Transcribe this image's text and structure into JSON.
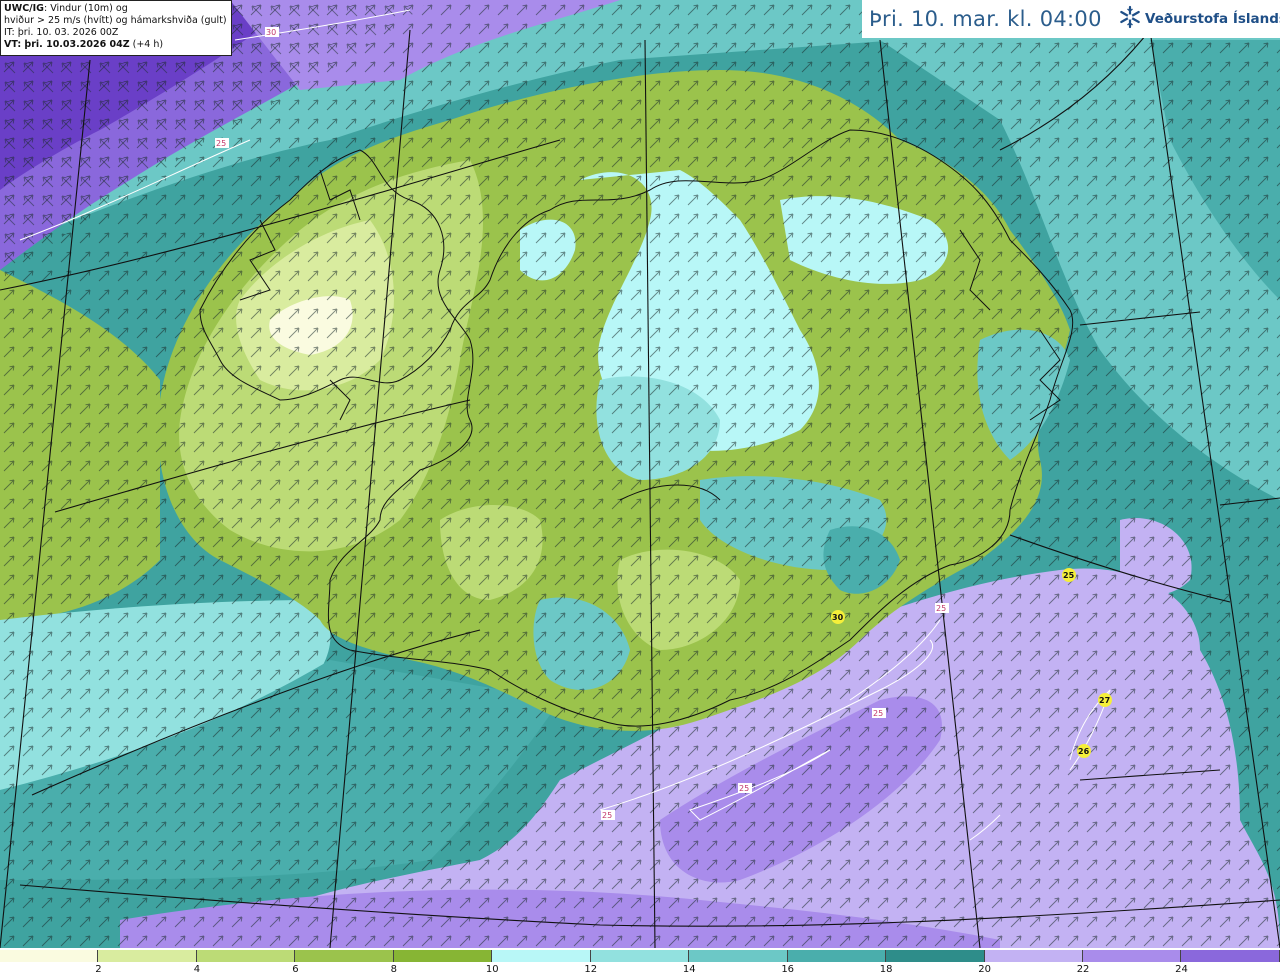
{
  "header": {
    "title": "Þri. 10. mar. kl. 04:00",
    "brand": "Veðurstofa Íslands",
    "brand_icon": "snowflake-logo-icon"
  },
  "info": {
    "model": "UWC/IG",
    "desc1": ": Vindur (10m) og",
    "desc2": "hviður > 25 m/s (hvítt) og hámarkshviða (gult)",
    "it": "IT: þri. 10. 03. 2026 00Z",
    "vt_label": "VT: þri. 10.03.2026 04Z",
    "vt_offset": "(+4 h)"
  },
  "legend": {
    "colors": [
      "#fafbe0",
      "#d9ec9f",
      "#bcdb76",
      "#9bc34c",
      "#87b534",
      "#b8f7f7",
      "#92e1df",
      "#6cc8c6",
      "#4aaeac",
      "#2e8d8a",
      "#c3b2f3",
      "#a98ceb",
      "#8a68dc",
      "#6a3fc7",
      "#4f23a8",
      "#f6a4a4"
    ],
    "ticks": [
      "2",
      "4",
      "6",
      "8",
      "10",
      "12",
      "14",
      "16",
      "18",
      "20",
      "22",
      "24"
    ]
  },
  "contour_labels": [
    {
      "text": "30",
      "kind": "white"
    },
    {
      "text": "25",
      "kind": "white"
    },
    {
      "text": "25",
      "kind": "white"
    },
    {
      "text": "25",
      "kind": "white"
    },
    {
      "text": "25",
      "kind": "white"
    },
    {
      "text": "25",
      "kind": "white"
    }
  ],
  "gust_labels": [
    "30",
    "25",
    "27",
    "26"
  ]
}
